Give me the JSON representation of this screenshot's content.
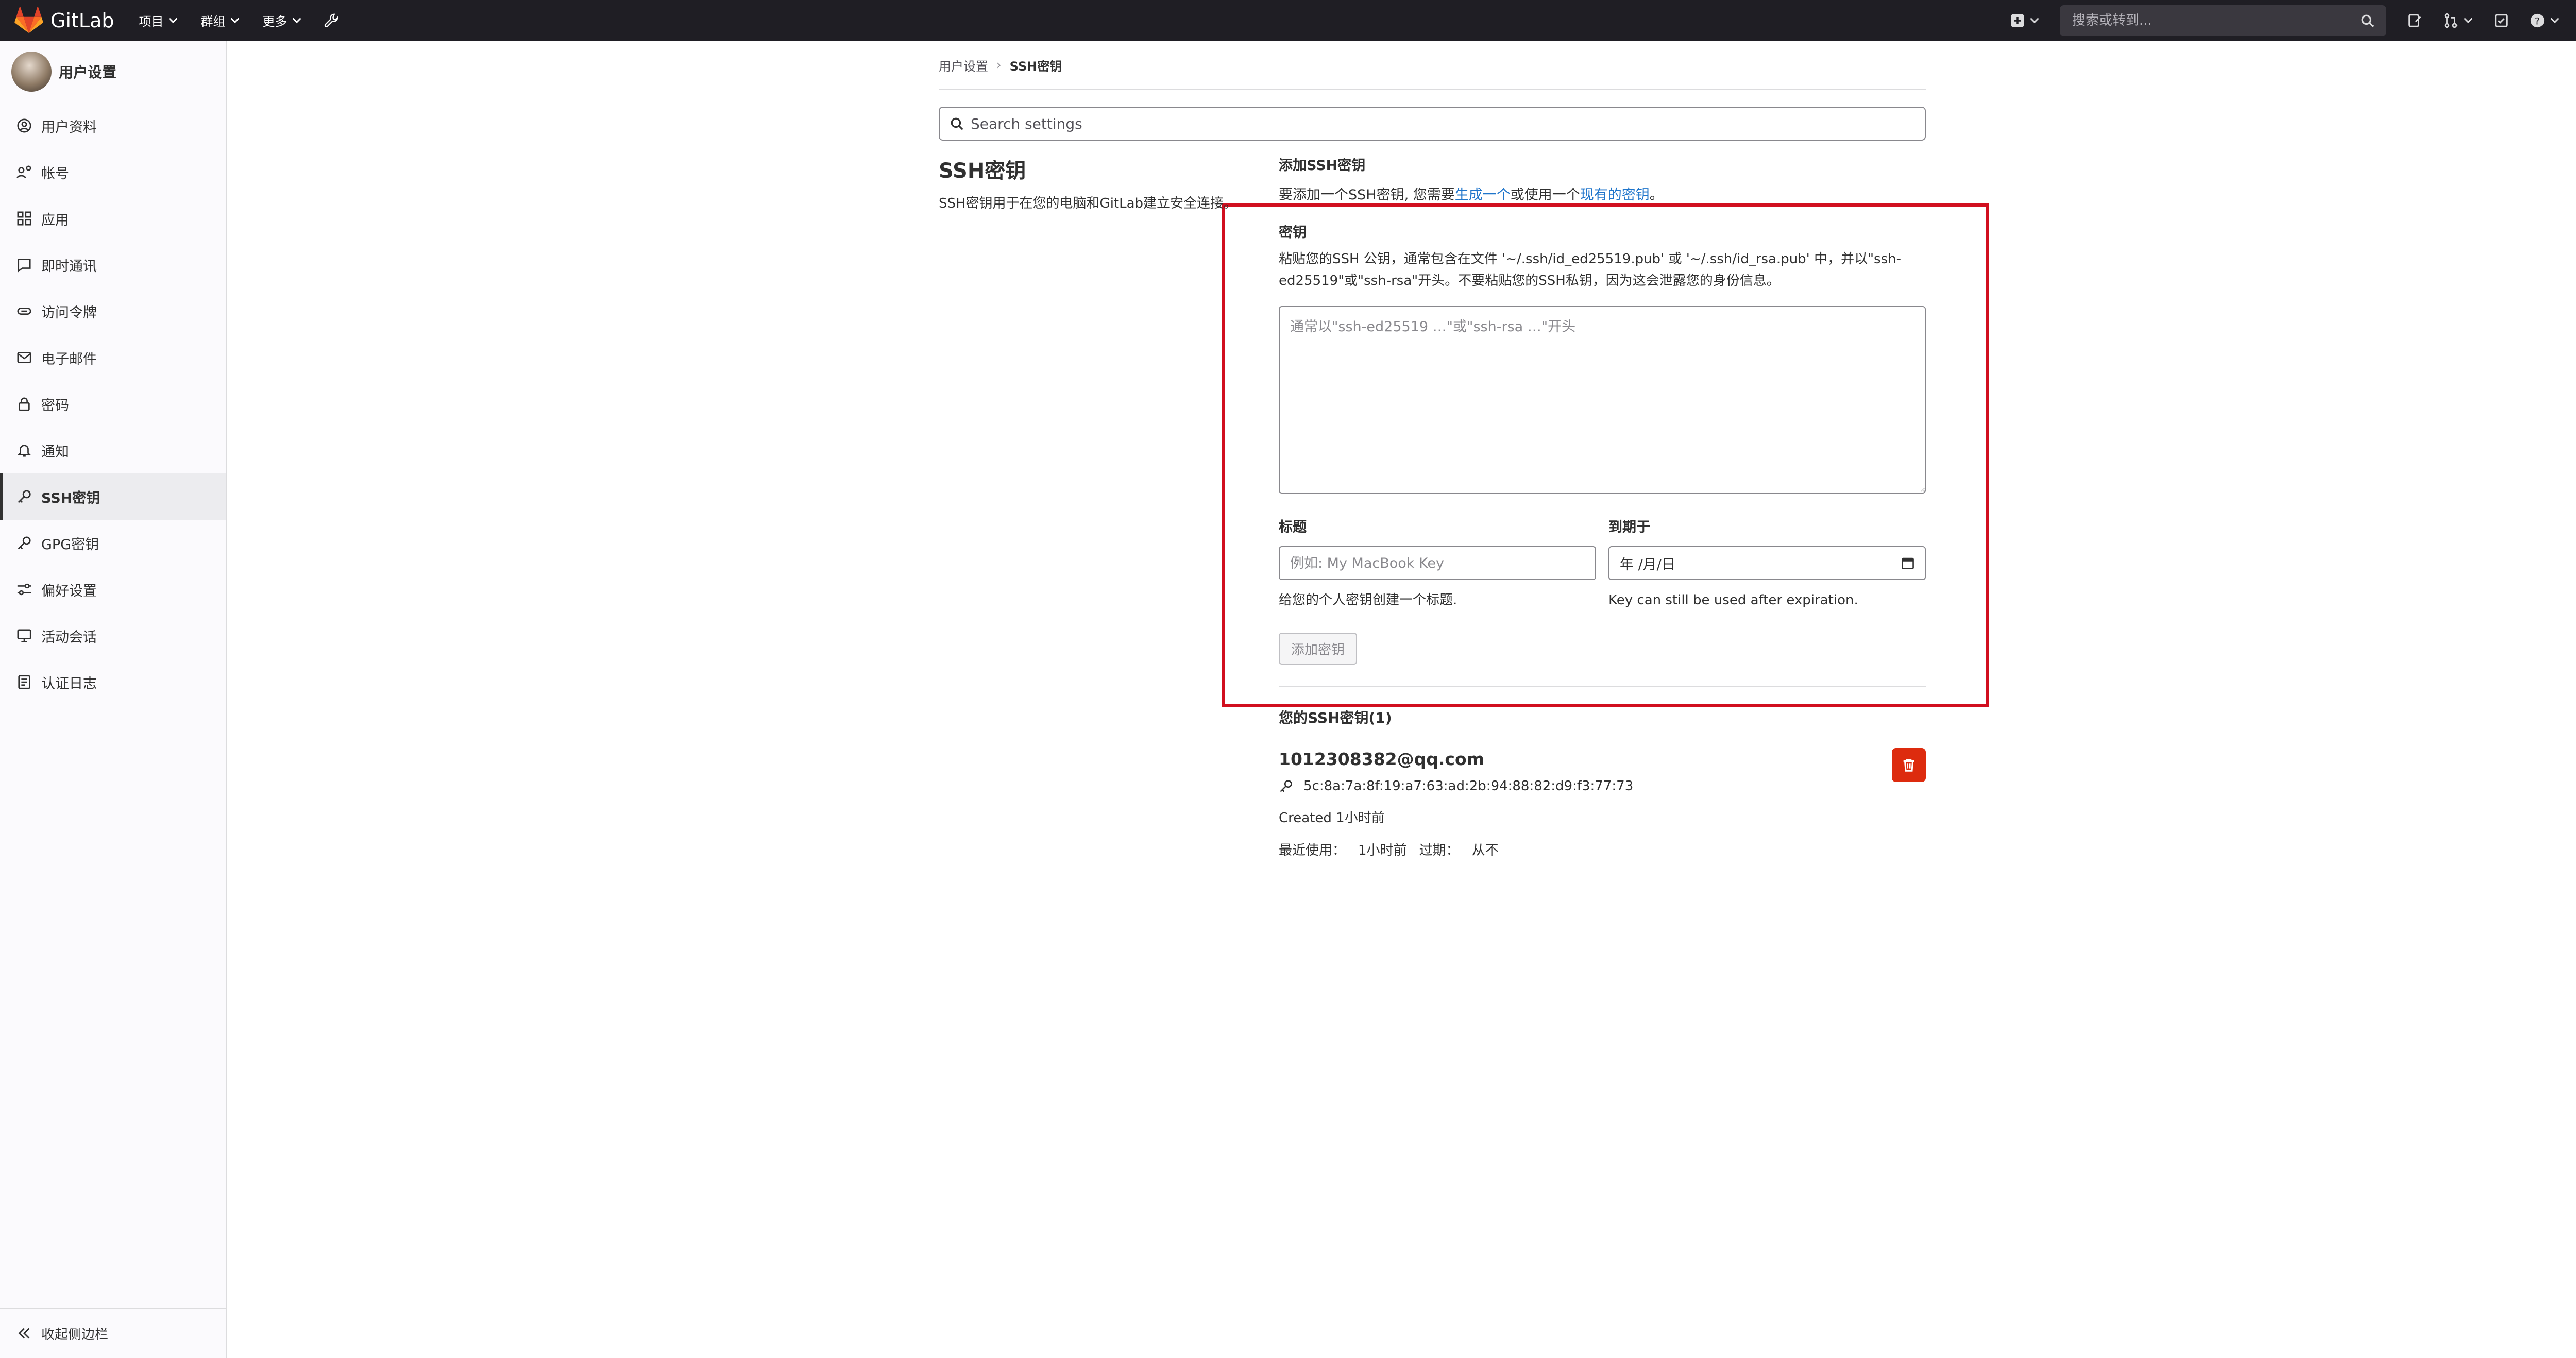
{
  "navbar": {
    "logo_text": "GitLab",
    "menu": [
      {
        "label": "项目"
      },
      {
        "label": "群组"
      },
      {
        "label": "更多"
      }
    ],
    "search_placeholder": "搜索或转到..."
  },
  "sidebar": {
    "title": "用户设置",
    "items": [
      {
        "label": "用户资料",
        "icon": "profile-icon"
      },
      {
        "label": "帐号",
        "icon": "account-icon"
      },
      {
        "label": "应用",
        "icon": "applications-icon"
      },
      {
        "label": "即时通讯",
        "icon": "chat-icon"
      },
      {
        "label": "访问令牌",
        "icon": "token-icon"
      },
      {
        "label": "电子邮件",
        "icon": "email-icon"
      },
      {
        "label": "密码",
        "icon": "lock-icon"
      },
      {
        "label": "通知",
        "icon": "bell-icon"
      },
      {
        "label": "SSH密钥",
        "icon": "key-icon",
        "active": true
      },
      {
        "label": "GPG密钥",
        "icon": "key-icon"
      },
      {
        "label": "偏好设置",
        "icon": "preferences-icon"
      },
      {
        "label": "活动会话",
        "icon": "monitor-icon"
      },
      {
        "label": "认证日志",
        "icon": "log-icon"
      }
    ],
    "collapse_label": "收起侧边栏"
  },
  "breadcrumb": {
    "parent": "用户设置",
    "current": "SSH密钥"
  },
  "settings_search": {
    "placeholder": "Search settings"
  },
  "section": {
    "title": "SSH密钥",
    "description": "SSH密钥用于在您的电脑和GitLab建立安全连接。"
  },
  "add_key": {
    "title": "添加SSH密钥",
    "desc_prefix": "要添加一个SSH密钥, 您需要",
    "link_generate": "生成一个",
    "desc_middle": "或使用一个",
    "link_existing": "现有的密钥",
    "desc_suffix": "。",
    "key_label": "密钥",
    "key_help": "粘贴您的SSH 公钥，通常包含在文件 '~/.ssh/id_ed25519.pub' 或 '~/.ssh/id_rsa.pub' 中，并以\"ssh-ed25519\"或\"ssh-rsa\"开头。不要粘贴您的SSH私钥，因为这会泄露您的身份信息。",
    "key_placeholder": "通常以\"ssh-ed25519 …\"或\"ssh-rsa …\"开头",
    "title_label": "标题",
    "title_placeholder": "例如: My MacBook Key",
    "title_help": "给您的个人密钥创建一个标题.",
    "expires_label": "到期于",
    "expires_value": "年 /月/日",
    "expires_help": "Key can still be used after expiration.",
    "submit_label": "添加密钥"
  },
  "your_keys": {
    "title": "您的SSH密钥(1)",
    "keys": [
      {
        "name": "1012308382@qq.com",
        "fingerprint": "5c:8a:7a:8f:19:a7:63:ad:2b:94:88:82:d9:f3:77:73",
        "created": "Created 1小时前",
        "last_used_label": "最近使用：",
        "last_used": "1小时前",
        "expires_label": "过期：",
        "expires": "从不"
      }
    ]
  },
  "colors": {
    "navbar_bg": "#1f1e24",
    "highlight_box": "#d10f1f",
    "delete_button": "#dd2b0e",
    "link": "#1f75cb"
  }
}
